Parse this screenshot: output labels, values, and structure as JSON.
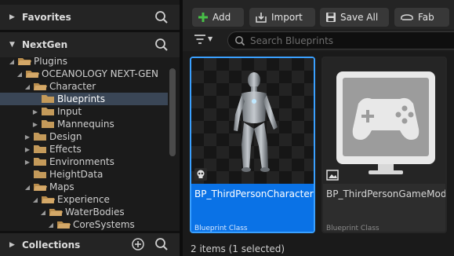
{
  "sidebar": {
    "favorites_label": "Favorites",
    "project_label": "NextGen",
    "collections_label": "Collections",
    "tree": [
      {
        "label": "Plugins"
      },
      {
        "label": "OCEANOLOGY NEXT-GEN"
      },
      {
        "label": "Character"
      },
      {
        "label": "Blueprints",
        "selected": true
      },
      {
        "label": "Input"
      },
      {
        "label": "Mannequins"
      },
      {
        "label": "Design"
      },
      {
        "label": "Effects"
      },
      {
        "label": "Environments"
      },
      {
        "label": "HeightData"
      },
      {
        "label": "Maps"
      },
      {
        "label": "Experience"
      },
      {
        "label": "WaterBodies"
      },
      {
        "label": "CoreSystems"
      }
    ]
  },
  "toolbar": {
    "add_label": "Add",
    "import_label": "Import",
    "save_all_label": "Save All",
    "fab_label": "Fab"
  },
  "search": {
    "placeholder": "Search Blueprints"
  },
  "assets": [
    {
      "name": "BP_ThirdPersonCharacter",
      "type": "Blueprint Class",
      "selected": true,
      "thumbnail": "mannequin-figure"
    },
    {
      "name": "BP_ThirdPersonGameMode",
      "type": "Blueprint Class",
      "selected": false,
      "thumbnail": "gamepad-monitor-icon"
    }
  ],
  "status": {
    "text": "2 items (1 selected)"
  },
  "colors": {
    "selection_blue": "#0a72e6",
    "add_green": "#48c048",
    "folder": "#c49a5a"
  }
}
